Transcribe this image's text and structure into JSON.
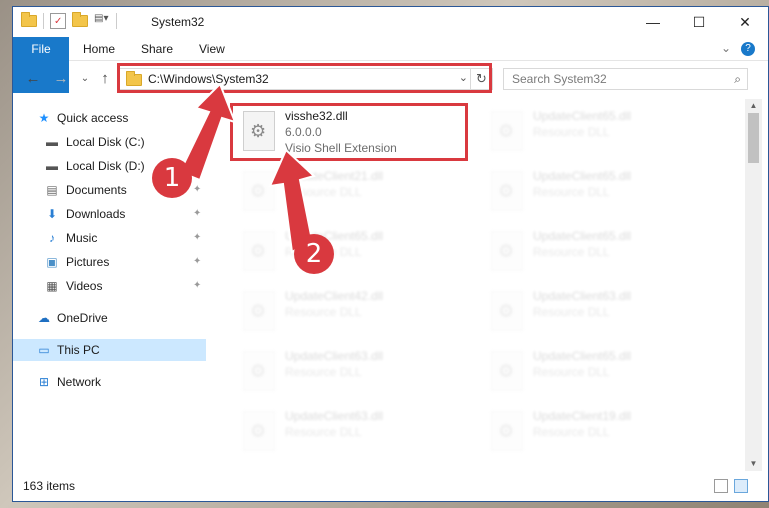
{
  "window": {
    "title": "System32",
    "controls": {
      "minimize": "—",
      "maximize": "☐",
      "close": "✕"
    }
  },
  "ribbon": {
    "tabs": [
      {
        "label": "File"
      },
      {
        "label": "Home"
      },
      {
        "label": "Share"
      },
      {
        "label": "View"
      }
    ],
    "help": "?",
    "expand": "⌄"
  },
  "address": {
    "path": "C:\\Windows\\System32",
    "dropdown": "⌄",
    "refresh": "↻",
    "back": "←",
    "forward": "→",
    "recent": "⌄",
    "up": "↑"
  },
  "search": {
    "placeholder": "Search System32",
    "icon": "search-icon"
  },
  "sidebar": {
    "items": [
      {
        "label": "Quick access",
        "icon": "star-icon",
        "glyph": "★",
        "color": "#1e90ff",
        "pinned": false
      },
      {
        "label": "Local Disk (C:)",
        "icon": "drive-icon",
        "glyph": "▬",
        "color": "#555555",
        "pinned": true
      },
      {
        "label": "Local Disk (D:)",
        "icon": "drive-icon",
        "glyph": "▬",
        "color": "#555555",
        "pinned": true
      },
      {
        "label": "Documents",
        "icon": "document-icon",
        "glyph": "▤",
        "color": "#6a6a6a",
        "pinned": true
      },
      {
        "label": "Downloads",
        "icon": "download-icon",
        "glyph": "⬇",
        "color": "#2a7fd4",
        "pinned": true
      },
      {
        "label": "Music",
        "icon": "music-icon",
        "glyph": "♪",
        "color": "#2a7fd4",
        "pinned": true
      },
      {
        "label": "Pictures",
        "icon": "pictures-icon",
        "glyph": "▣",
        "color": "#4a90c8",
        "pinned": true
      },
      {
        "label": "Videos",
        "icon": "video-icon",
        "glyph": "▦",
        "color": "#555555",
        "pinned": true
      },
      {
        "label": "OneDrive",
        "icon": "cloud-icon",
        "glyph": "☁",
        "color": "#1e6fc2",
        "pinned": false
      },
      {
        "label": "This PC",
        "icon": "computer-icon",
        "glyph": "▭",
        "color": "#2a7fd4",
        "pinned": false,
        "selected": true
      },
      {
        "label": "Network",
        "icon": "network-icon",
        "glyph": "⊞",
        "color": "#2a7fd4",
        "pinned": false
      }
    ],
    "pin_glyph": "📌"
  },
  "files": [
    {
      "name": "visshe32.dll",
      "version": "6.0.0.0",
      "description": "Visio Shell Extension",
      "highlighted": true
    },
    {
      "name": "UpdateClient65.dll",
      "description": "Resource DLL"
    },
    {
      "name": "UpdateClient21.dll",
      "description": "Resource DLL"
    },
    {
      "name": "UpdateClient65.dll",
      "description": "Resource DLL"
    },
    {
      "name": "UpdateClient65.dll",
      "description": "Resource DLL"
    },
    {
      "name": "UpdateClient65.dll",
      "description": "Resource DLL"
    },
    {
      "name": "UpdateClient42.dll",
      "description": "Resource DLL"
    },
    {
      "name": "UpdateClient63.dll",
      "description": "Resource DLL"
    },
    {
      "name": "UpdateClient63.dll",
      "description": "Resource DLL"
    },
    {
      "name": "UpdateClient65.dll",
      "description": "Resource DLL"
    },
    {
      "name": "UpdateClient63.dll",
      "description": "Resource DLL"
    },
    {
      "name": "UpdateClient19.dll",
      "description": "Resource DLL"
    }
  ],
  "status": {
    "item_count": "163 items"
  },
  "annotations": {
    "badge1": "1",
    "badge2": "2",
    "color": "#d9393f"
  }
}
